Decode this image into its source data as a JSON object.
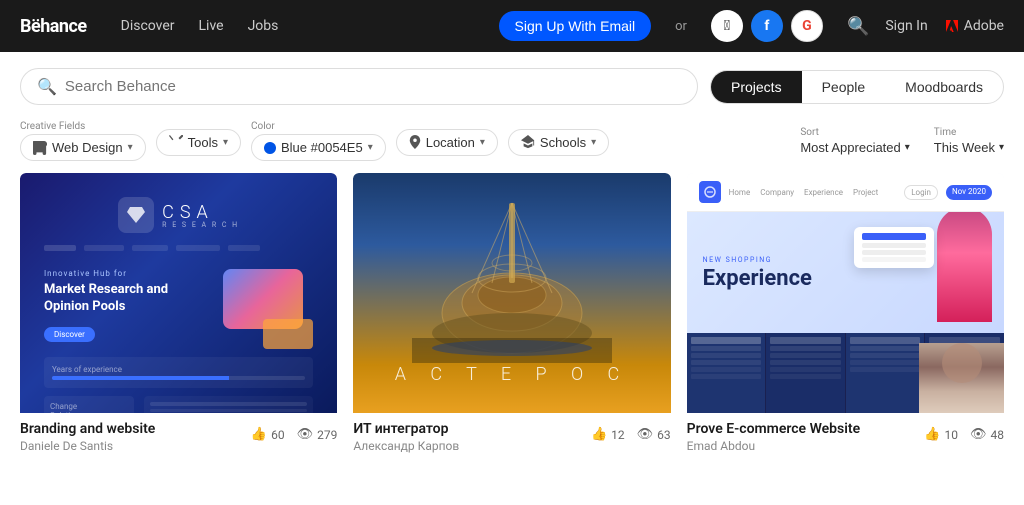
{
  "nav": {
    "logo": "Bëhance",
    "links": [
      "Discover",
      "Live",
      "Jobs"
    ],
    "signup_btn": "Sign Up With Email",
    "or_text": "or",
    "signin_text": "Sign In",
    "adobe_text": "Adobe",
    "search_placeholder": "Search Behance"
  },
  "tabs": {
    "projects_label": "Projects",
    "people_label": "People",
    "moodboards_label": "Moodboards"
  },
  "filters": {
    "creative_fields_label": "Creative Fields",
    "web_design_label": "Web Design",
    "tools_label": "Tools",
    "color_label": "Color",
    "color_value": "Blue #0054E5",
    "location_label": "Location",
    "location_value": "Location",
    "schools_label": "Schools",
    "schools_value": "Schools",
    "sort_label": "Sort",
    "sort_value": "Most Appreciated",
    "time_label": "Time",
    "time_value": "This Week"
  },
  "projects": [
    {
      "id": 1,
      "title": "Branding and website",
      "author": "Daniele De Santis",
      "likes": "60",
      "views": "279",
      "type": "csa"
    },
    {
      "id": 2,
      "title": "ИТ интегратор",
      "author": "Александр Карпов",
      "likes": "12",
      "views": "63",
      "type": "ast"
    },
    {
      "id": 3,
      "title": "Prove E-commerce Website",
      "author": "Emad Abdou",
      "likes": "10",
      "views": "48",
      "type": "prova"
    }
  ]
}
